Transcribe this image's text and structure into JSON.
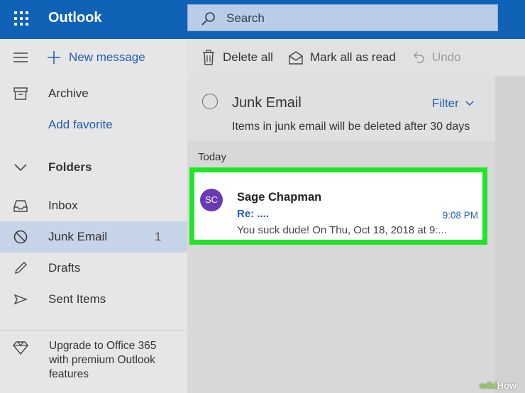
{
  "app": {
    "title": "Outlook"
  },
  "search": {
    "placeholder": "Search"
  },
  "sidebar": {
    "new_message": "New message",
    "items": [
      {
        "label": "Archive",
        "icon": "archive-icon"
      },
      {
        "label": "Add favorite"
      },
      {
        "label": "Folders",
        "icon": "chevron-down-icon"
      },
      {
        "label": "Inbox",
        "icon": "inbox-icon"
      },
      {
        "label": "Junk Email",
        "icon": "block-icon",
        "count": "1",
        "selected": true
      },
      {
        "label": "Drafts",
        "icon": "pencil-icon"
      },
      {
        "label": "Sent Items",
        "icon": "send-icon"
      }
    ],
    "upgrade_text": "Upgrade to Office 365 with premium Outlook features"
  },
  "toolbar": {
    "delete_all": "Delete all",
    "mark_all_read": "Mark all as read",
    "undo": "Undo"
  },
  "folder": {
    "name": "Junk Email",
    "filter": "Filter",
    "note": "Items in junk email will be deleted after 30 days",
    "group_label": "Today"
  },
  "messages": [
    {
      "initials": "SC",
      "sender": "Sage Chapman",
      "subject": "Re: ....",
      "time": "9:08 PM",
      "preview": "You suck dude! On Thu, Oct 18, 2018 at 9:..."
    }
  ],
  "watermark": {
    "prefix": "wiki",
    "suffix": "How"
  },
  "colors": {
    "brand": "#0f62b5",
    "accent": "#1f5fb5",
    "highlight": "#22e52a",
    "avatar": "#6a3ab5"
  }
}
